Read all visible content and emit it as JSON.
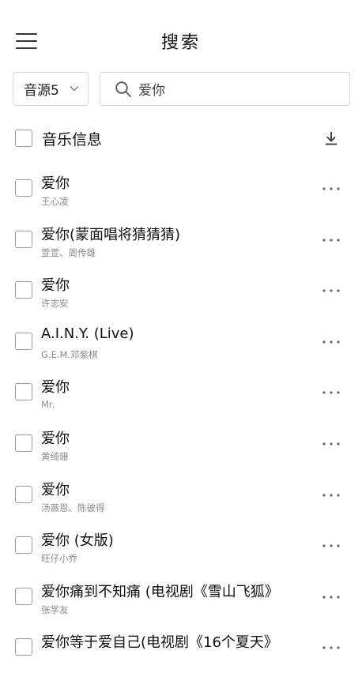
{
  "header": {
    "title": "搜索",
    "menu_icon": "hamburger-menu-icon"
  },
  "search": {
    "source_label": "音源5",
    "query": "爱你",
    "search_icon": "search-icon",
    "dropdown_icon": "chevron-down-icon"
  },
  "list_header": {
    "label": "音乐信息",
    "download_icon": "download-icon"
  },
  "songs": [
    {
      "title": "爱你",
      "artist": "王心凌"
    },
    {
      "title": "爱你(蒙面唱将猜猜猜)",
      "artist": "萱萱、周传雄"
    },
    {
      "title": "爱你",
      "artist": "许志安"
    },
    {
      "title": "A.I.N.Y. (Live)",
      "artist": "G.E.M.邓紫棋"
    },
    {
      "title": "爱你",
      "artist": "Mr."
    },
    {
      "title": "爱你",
      "artist": "黄绮珊"
    },
    {
      "title": "爱你",
      "artist": "汤薇恩、陈彼得"
    },
    {
      "title": "爱你 (女版)",
      "artist": "旺仔小乔"
    },
    {
      "title": "爱你痛到不知痛 (电视剧《雪山飞狐》",
      "artist": "张学友"
    },
    {
      "title": "爱你等于爱自己(电视剧《16个夏天》",
      "artist": ""
    }
  ],
  "colors": {
    "text": "#111111",
    "secondary_text": "#8a8a8a",
    "border": "#d9d9d9",
    "background": "#ffffff"
  }
}
